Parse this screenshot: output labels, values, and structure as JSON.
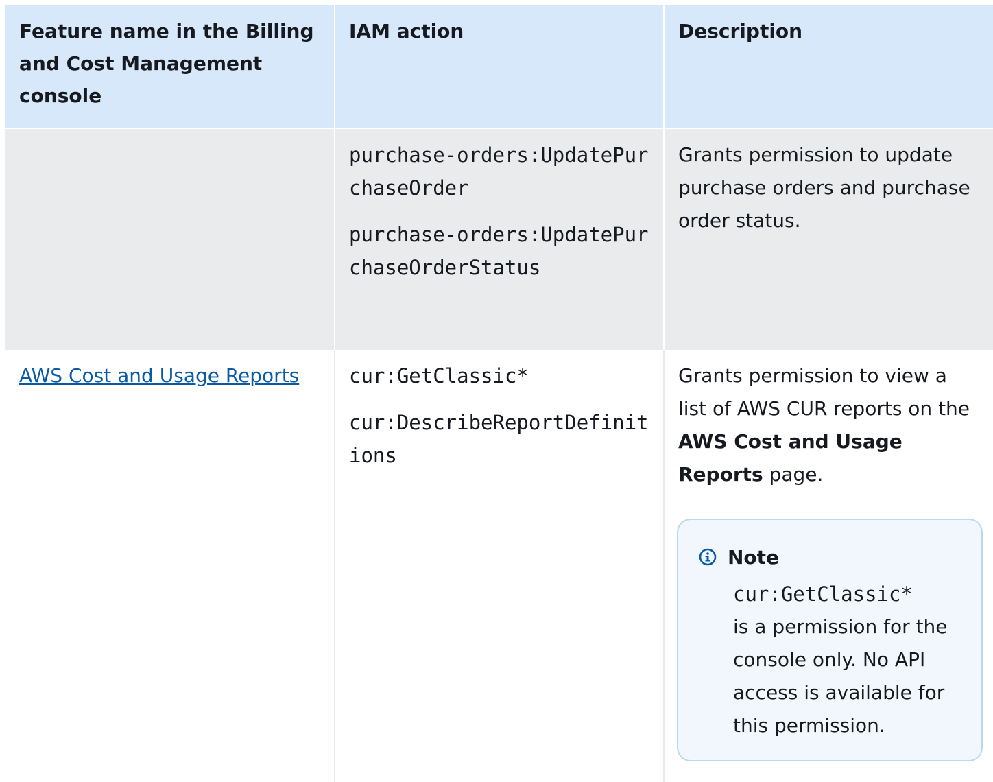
{
  "table": {
    "headers": [
      "Feature name in the Billing and Cost Management console",
      "IAM action",
      "Description"
    ],
    "row1": {
      "feature": "",
      "actions": [
        "purchase-orders:UpdatePurchaseOrder",
        "purchase-orders:UpdatePurchaseOrderStatus"
      ],
      "description": "Grants permission to update purchase orders and purchase order status."
    },
    "row2": {
      "feature_link": "AWS Cost and Usage Reports",
      "actions": [
        "cur:GetClassic*",
        "cur:DescribeReportDefinitions"
      ],
      "description_pre": "Grants permission to view a list of AWS CUR reports on the ",
      "description_bold": "AWS Cost and Usage Reports",
      "description_post": " page.",
      "note": {
        "icon": "info-icon",
        "title": "Note",
        "code": "cur:GetClassic*",
        "text": "is a permission for the console only. No API access is available for this permission."
      }
    }
  },
  "colors": {
    "header_bg": "#d6e8f9",
    "shaded_row_bg": "#e9ebed",
    "link": "#0a5ba6",
    "note_border": "#bdd7ee",
    "note_bg": "#f1f7fd",
    "info_icon": "#0a5ba6"
  }
}
